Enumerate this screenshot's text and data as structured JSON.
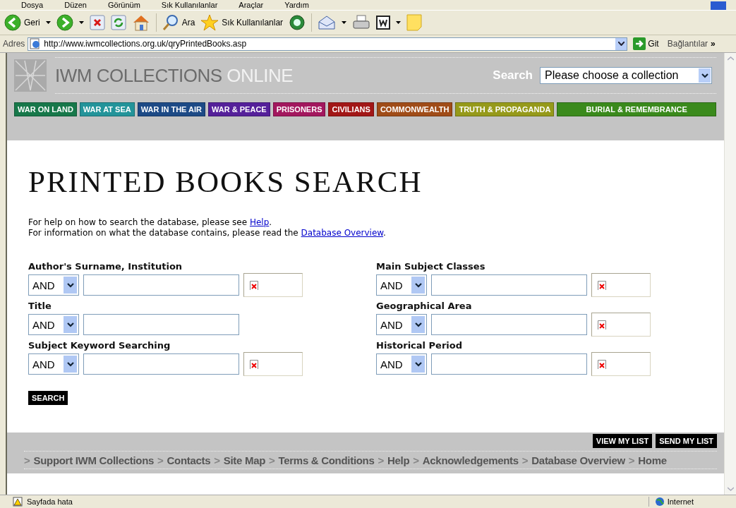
{
  "menu_bar": [
    "Dosya",
    "Düzen",
    "Görünüm",
    "Sık Kullanılanlar",
    "Araçlar",
    "Yardım"
  ],
  "toolbar": {
    "back": "Geri",
    "search": "Ara",
    "favorites": "Sık Kullanılanlar"
  },
  "address_bar": {
    "label": "Adres",
    "url": "http://www.iwmcollections.org.uk/qryPrintedBooks.asp",
    "go": "Git",
    "links": "Bağlantılar",
    "more": "»"
  },
  "site_header": {
    "logo": "IWM COLLECTIONS",
    "logo_accent": "ONLINE",
    "search_label": "Search",
    "collection_select": "Please choose a collection",
    "nav": [
      {
        "label": "WAR ON LAND",
        "color": "#17784a"
      },
      {
        "label": "WAR AT SEA",
        "color": "#23949a"
      },
      {
        "label": "WAR IN THE AIR",
        "color": "#1d4a86"
      },
      {
        "label": "WAR & PEACE",
        "color": "#55209a"
      },
      {
        "label": "PRISONERS",
        "color": "#a3175e"
      },
      {
        "label": "CIVILIANS",
        "color": "#a21717"
      },
      {
        "label": "COMMONWEALTH",
        "color": "#a04c18"
      },
      {
        "label": "TRUTH & PROPAGANDA",
        "color": "#969a1a"
      },
      {
        "label": "BURIAL & REMEMBRANCE",
        "color": "#3a8a1c"
      }
    ]
  },
  "page": {
    "title": "PRINTED BOOKS SEARCH",
    "help_lines": [
      {
        "before": "For help on how to search the database, please see ",
        "link": "Help",
        "after": "."
      },
      {
        "before": "For information on what the database contains, please read the ",
        "link": "Database Overview",
        "after": "."
      }
    ]
  },
  "form": {
    "columns": [
      [
        {
          "label": "Author's Surname, Institution",
          "operator": "AND",
          "lookup": true
        },
        {
          "label": "Title",
          "operator": "AND",
          "lookup": false
        },
        {
          "label": "Subject Keyword Searching",
          "operator": "AND",
          "lookup": true
        }
      ],
      [
        {
          "label": "Main Subject Classes",
          "operator": "AND",
          "lookup": true
        },
        {
          "label": "Geographical Area",
          "operator": "AND",
          "lookup": true
        },
        {
          "label": "Historical Period",
          "operator": "AND",
          "lookup": true
        }
      ]
    ],
    "search_button": "SEARCH"
  },
  "footer": {
    "buttons": [
      "VIEW MY LIST",
      "SEND MY LIST"
    ],
    "separator": ">",
    "links": [
      "Support IWM Collections",
      "Contacts",
      "Site Map",
      "Terms & Conditions",
      "Help",
      "Acknowledgements",
      "Database Overview",
      "Home"
    ]
  },
  "status_bar": {
    "message": "Sayfada hata",
    "zone": "Internet"
  }
}
